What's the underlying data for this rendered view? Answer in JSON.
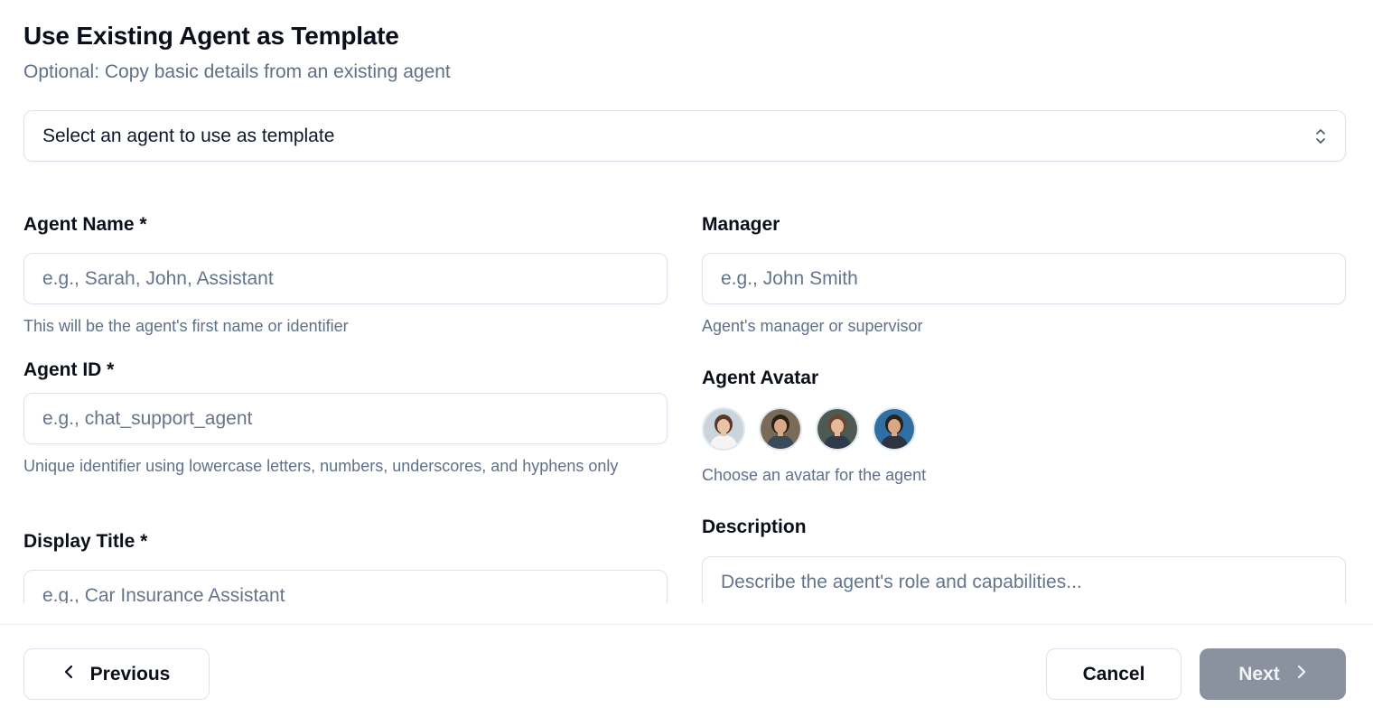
{
  "header": {
    "title": "Use Existing Agent as Template",
    "subtitle": "Optional: Copy basic details from an existing agent"
  },
  "template_select": {
    "selected": "Select an agent to use as template",
    "icon": "chevron-up-down-icon"
  },
  "form": {
    "agent_name": {
      "label": "Agent Name *",
      "placeholder": "e.g., Sarah, John, Assistant",
      "help": "This will be the agent's first name or identifier"
    },
    "agent_id": {
      "label": "Agent ID *",
      "placeholder": "e.g., chat_support_agent",
      "help": "Unique identifier using lowercase letters, numbers, underscores, and hyphens only"
    },
    "display_title": {
      "label": "Display Title *",
      "placeholder": "e.g., Car Insurance Assistant"
    },
    "manager": {
      "label": "Manager",
      "placeholder": "e.g., John Smith",
      "help": "Agent's manager or supervisor"
    },
    "avatar": {
      "label": "Agent Avatar",
      "help": "Choose an avatar for the agent",
      "options": [
        {
          "name": "avatar-1",
          "bg": "#c9d4dc",
          "hair": "#5a3a26",
          "shirt": "#f4f4f4",
          "skin": "#e8c3a6"
        },
        {
          "name": "avatar-2",
          "bg": "#7a6a58",
          "hair": "#2c2118",
          "shirt": "#3b4a58",
          "skin": "#d9a988"
        },
        {
          "name": "avatar-3",
          "bg": "#4d5a52",
          "hair": "#6a4630",
          "shirt": "#2f3a4a",
          "skin": "#e5b99a"
        },
        {
          "name": "avatar-4",
          "bg": "#2f6fa3",
          "hair": "#2a211c",
          "shirt": "#2b3440",
          "skin": "#d8a886"
        }
      ]
    },
    "description": {
      "label": "Description",
      "placeholder": "Describe the agent's role and capabilities..."
    }
  },
  "footer": {
    "previous_label": "Previous",
    "cancel_label": "Cancel",
    "next_label": "Next"
  },
  "colors": {
    "muted_text": "#5f7089",
    "border": "#dde3ec",
    "next_disabled_bg": "#8a929f"
  }
}
